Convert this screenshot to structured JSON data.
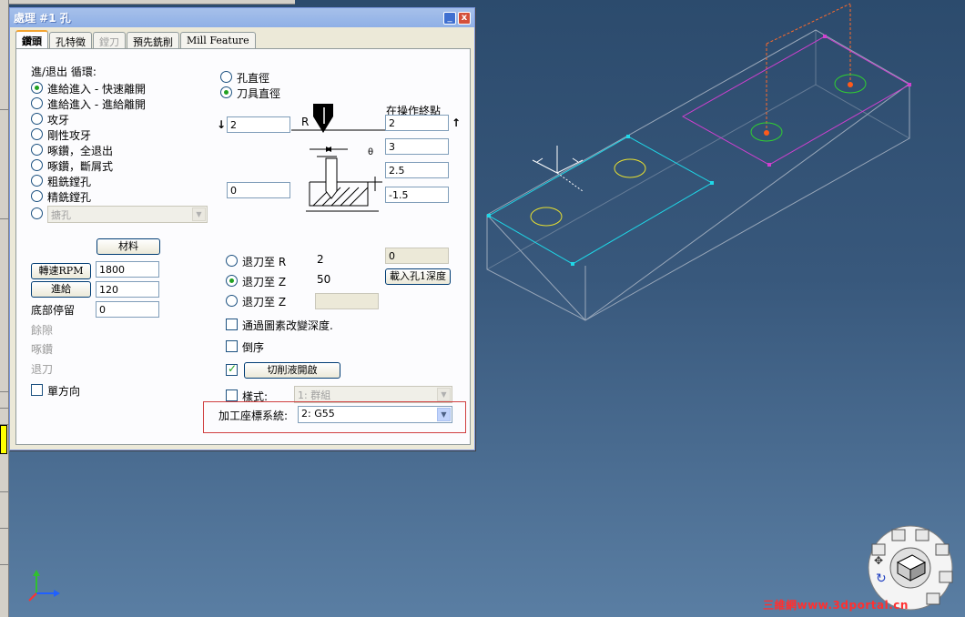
{
  "window": {
    "title": "處理 #1 孔",
    "minimize_glyph": "_",
    "close_glyph": "x"
  },
  "tabs": [
    {
      "label": "鑽頭",
      "state": "active"
    },
    {
      "label": "孔特徵",
      "state": "normal"
    },
    {
      "label": "鏜刀",
      "state": "disabled"
    },
    {
      "label": "預先銑削",
      "state": "normal"
    },
    {
      "label": "Mill Feature",
      "state": "normal"
    }
  ],
  "cycle": {
    "heading": "進/退出 循環:",
    "options": [
      {
        "label": "進給進入 - 快速離開",
        "checked": true
      },
      {
        "label": "進給進入 - 進給離開",
        "checked": false
      },
      {
        "label": "攻牙",
        "checked": false
      },
      {
        "label": "剛性攻牙",
        "checked": false
      },
      {
        "label": "啄鑽，全退出",
        "checked": false
      },
      {
        "label": "啄鑽，斷屑式",
        "checked": false
      },
      {
        "label": "粗銑鏜孔",
        "checked": false
      },
      {
        "label": "精銑鏜孔",
        "checked": false
      }
    ],
    "extra_select": {
      "value": "搪孔",
      "enabled": false
    }
  },
  "material_button": "材料",
  "spindle": {
    "label": "轉速RPM",
    "value": "1800"
  },
  "feed": {
    "label": "進給",
    "value": "120"
  },
  "dwell": {
    "label": "底部停留",
    "value": "0"
  },
  "disabled_labels": [
    "餘隙",
    "啄鑽",
    "退刀"
  ],
  "one_direction": {
    "label": "單方向",
    "checked": false
  },
  "diameter": {
    "options": [
      {
        "label": "孔直徑",
        "checked": false
      },
      {
        "label": "刀具直徑",
        "checked": true
      }
    ]
  },
  "end_point_label": "在操作終點",
  "diagram": {
    "r_label": "R",
    "left_top_value": "2",
    "left_bottom_value": "0",
    "right_values": [
      "2",
      "3",
      "2.5",
      "-1.5"
    ]
  },
  "retract": {
    "options": [
      {
        "label": "退刀至 R",
        "value": "2",
        "checked": false
      },
      {
        "label": "退刀至 Z",
        "value": "50",
        "checked": true
      },
      {
        "label": "退刀至 Z",
        "value": "",
        "checked": false
      }
    ],
    "side_value": "0",
    "load_depth_button": "載入孔1深度"
  },
  "options": {
    "change_depth": {
      "label": "通過圖素改變深度.",
      "checked": false
    },
    "reverse": {
      "label": "倒序",
      "checked": false
    },
    "coolant": {
      "checked": true,
      "button": "切削液開啟"
    },
    "style": {
      "label": "樣式:",
      "checked": false,
      "select": "1: 群組"
    }
  },
  "wcs": {
    "label": "加工座標系統:",
    "value": "2: G55"
  },
  "viewport": {
    "colors": {
      "box_edges": "#9aa8ba",
      "selected_face": "#1fd8e8",
      "second_face": "#d040d0",
      "hole_yellow": "#e8e030",
      "hole_green": "#30d030",
      "hole_center": "#ff5a1a"
    }
  },
  "watermark": "三維網www.3dportal.cn"
}
